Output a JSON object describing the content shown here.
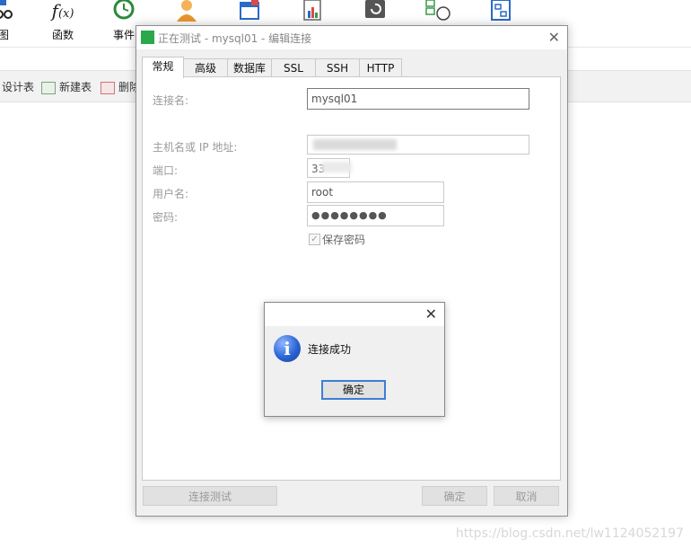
{
  "toolbar": {
    "items": [
      {
        "label": "图",
        "icon": "view-icon"
      },
      {
        "label": "函数",
        "icon": "function-icon"
      },
      {
        "label": "事件",
        "icon": "event-clock-icon"
      },
      {
        "label": "",
        "icon": "user-icon"
      },
      {
        "label": "",
        "icon": "table-calendar-icon"
      },
      {
        "label": "",
        "icon": "report-icon"
      },
      {
        "label": "",
        "icon": "backup-icon"
      },
      {
        "label": "",
        "icon": "schedule-icon"
      },
      {
        "label": "",
        "icon": "model-icon"
      }
    ]
  },
  "subbar": {
    "design_table": "设计表",
    "new_table": "新建表",
    "delete_table": "删除"
  },
  "dialog": {
    "title": "正在测试 - mysql01 - 编辑连接",
    "tabs": [
      "常规",
      "高级",
      "数据库",
      "SSL",
      "SSH",
      "HTTP"
    ],
    "active_tab": "常规",
    "fields": {
      "connection_name_label": "连接名:",
      "connection_name_value": "mysql01",
      "host_label": "主机名或 IP 地址:",
      "host_value": "",
      "port_label": "端口:",
      "port_value": "33",
      "username_label": "用户名:",
      "username_value": "root",
      "password_label": "密码:",
      "password_value": "●●●●●●●●",
      "save_password_label": "保存密码",
      "save_password_checked": true
    },
    "buttons": {
      "test_connection": "连接测试",
      "ok": "确定",
      "cancel": "取消"
    }
  },
  "message_box": {
    "icon": "info-icon",
    "text": "连接成功",
    "ok": "确定"
  },
  "watermark": "https://blog.csdn.net/lw1124052197"
}
